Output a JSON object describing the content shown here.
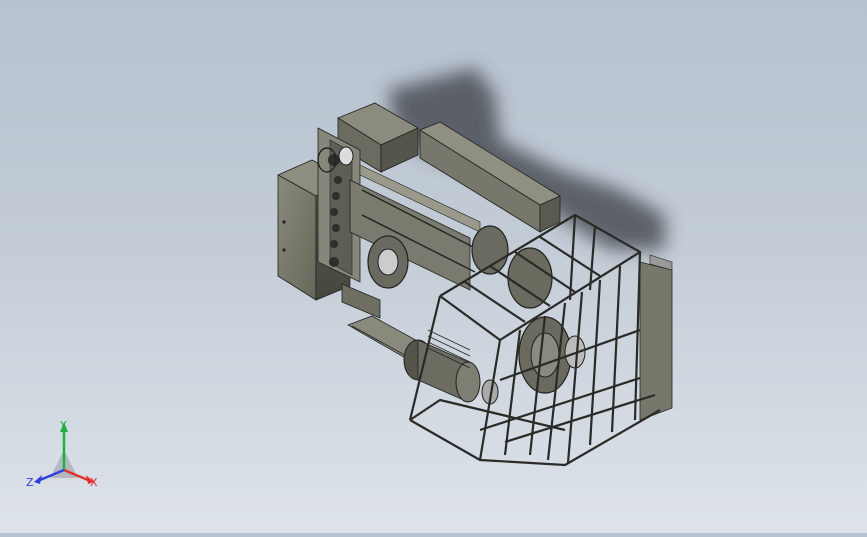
{
  "viewport": {
    "background_top": "#b6c2cf",
    "background_bottom": "#dee3ea",
    "model_color": "#77776a",
    "model_dark": "#4a4a40",
    "shadow_color": "#3a3d44"
  },
  "triad": {
    "x_label": "X",
    "y_label": "Y",
    "z_label": "Z",
    "x_color": "#e03030",
    "y_color": "#20b040",
    "z_color": "#3040e0"
  }
}
